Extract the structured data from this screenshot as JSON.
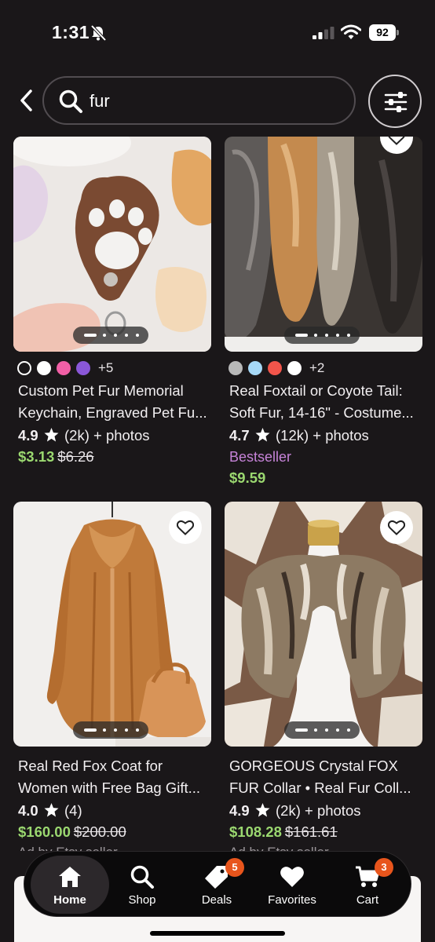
{
  "status_bar": {
    "time": "1:31",
    "battery": "92"
  },
  "search": {
    "query": "fur"
  },
  "products": [
    {
      "title_line1": "Custom Pet Fur Memorial",
      "title_line2": "Keychain, Engraved Pet Fu...",
      "rating": "4.9",
      "reviews": "(2k) + photos",
      "price": "$3.13",
      "original_price": "$6.26",
      "swatch_colors": [
        "#1a1719",
        "#ffffff",
        "#f25fa6",
        "#8a57d8"
      ],
      "swatch_more": "+5"
    },
    {
      "title_line1": "Real Foxtail or Coyote Tail:",
      "title_line2": "Soft Fur, 14-16\" - Costume...",
      "rating": "4.7",
      "reviews": "(12k) + photos",
      "badge": "Bestseller",
      "price": "$9.59",
      "swatch_colors": [
        "#b8b8b8",
        "#a6d8f7",
        "#f2554b",
        "#ffffff"
      ],
      "swatch_more": "+2"
    },
    {
      "title_line1": "Real Red Fox Coat for",
      "title_line2": "Women with Free Bag Gift...",
      "rating": "4.0",
      "reviews": "(4)",
      "price": "$160.00",
      "original_price": "$200.00",
      "ad_label": "Ad by Etsy seller"
    },
    {
      "title_line1": "GORGEOUS Crystal FOX",
      "title_line2": "FUR Collar • Real Fur Coll...",
      "rating": "4.9",
      "reviews": "(2k) + photos",
      "price": "$108.28",
      "original_price": "$161.61",
      "ad_label": "Ad by Etsy seller"
    }
  ],
  "tab_bar": {
    "tabs": [
      {
        "label": "Home",
        "icon": "house-icon",
        "active": true
      },
      {
        "label": "Shop",
        "icon": "search-icon"
      },
      {
        "label": "Deals",
        "icon": "tag-icon",
        "badge": "5"
      },
      {
        "label": "Favorites",
        "icon": "heart-icon"
      },
      {
        "label": "Cart",
        "icon": "cart-icon",
        "badge": "3"
      }
    ]
  },
  "colors": {
    "background": "#1a1719",
    "sale_price": "#9bd870",
    "bestseller": "#c683d8",
    "badge": "#e8551c"
  }
}
